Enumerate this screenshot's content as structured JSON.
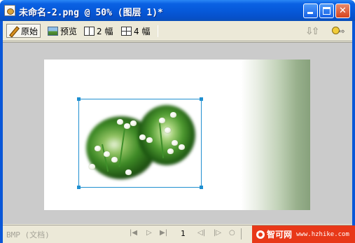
{
  "window": {
    "title": "未命名-2.png @  50% (图层 1)*",
    "minimize_label": "_",
    "maximize_label": "□",
    "close_label": "✕"
  },
  "toolbar": {
    "original_label": "原始",
    "preview_label": "预览",
    "twoup_label": "2 幅",
    "fourup_label": "4 幅",
    "right_icon_glyph": "⇩⇧",
    "key_arrow": "⇨"
  },
  "status": {
    "text": "BMP (文档)",
    "nav_first": "|◀",
    "nav_play": "▷",
    "nav_last": "▶|",
    "page": "1",
    "nav_prev": "◁|",
    "nav_next": "|▷",
    "nav_loop": "○"
  },
  "watermark": {
    "brand": "智可网",
    "url": "www.hzhike.com"
  },
  "colors": {
    "titlebar": "#0658d8",
    "selection": "#1f8fd0",
    "canvas_bg": "#cbcbcb",
    "gradient_end": "#87a17c"
  }
}
